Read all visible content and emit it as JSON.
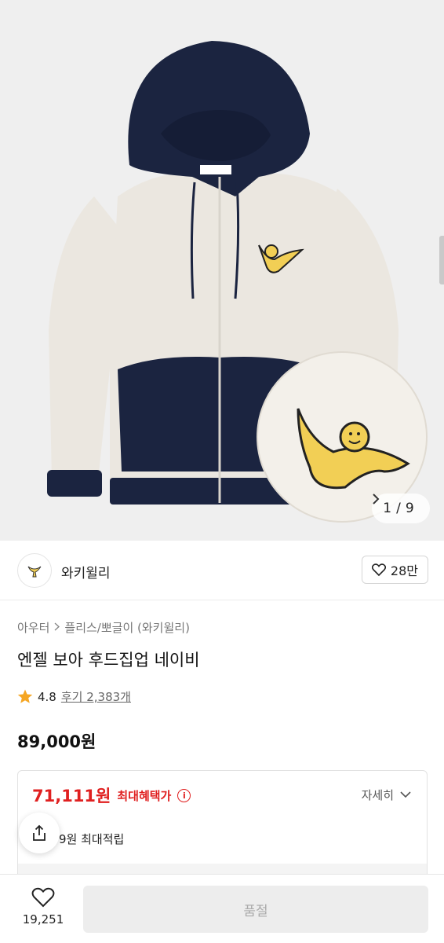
{
  "colors": {
    "accent_red": "#e02020",
    "rating_star": "#f5a623",
    "navy": "#1b2440",
    "cream": "#ebe7e0",
    "mascot_yellow": "#f2cf55"
  },
  "gallery": {
    "current": "1",
    "separator": "/",
    "total": "9",
    "next_icon": "chevron-right-icon"
  },
  "brand": {
    "logo_icon": "wakywilly-logo-icon",
    "name": "와키윌리",
    "like_count": "28만"
  },
  "breadcrumb": {
    "items": [
      "아우터",
      "플리스/뽀글이 (와키윌리)"
    ]
  },
  "product": {
    "title": "엔젤 보아 후드집업 네이비",
    "rating": "4.8",
    "reviews": "후기 2,383개",
    "price": "89,000원"
  },
  "benefit": {
    "sale_price": "71,111원",
    "sale_label": "최대혜택가",
    "info_icon": "i",
    "detail_label": "자세히",
    "points_text": "9원 최대적립"
  },
  "bottom_bar": {
    "wish_count": "19,251",
    "soldout_label": "품절"
  }
}
